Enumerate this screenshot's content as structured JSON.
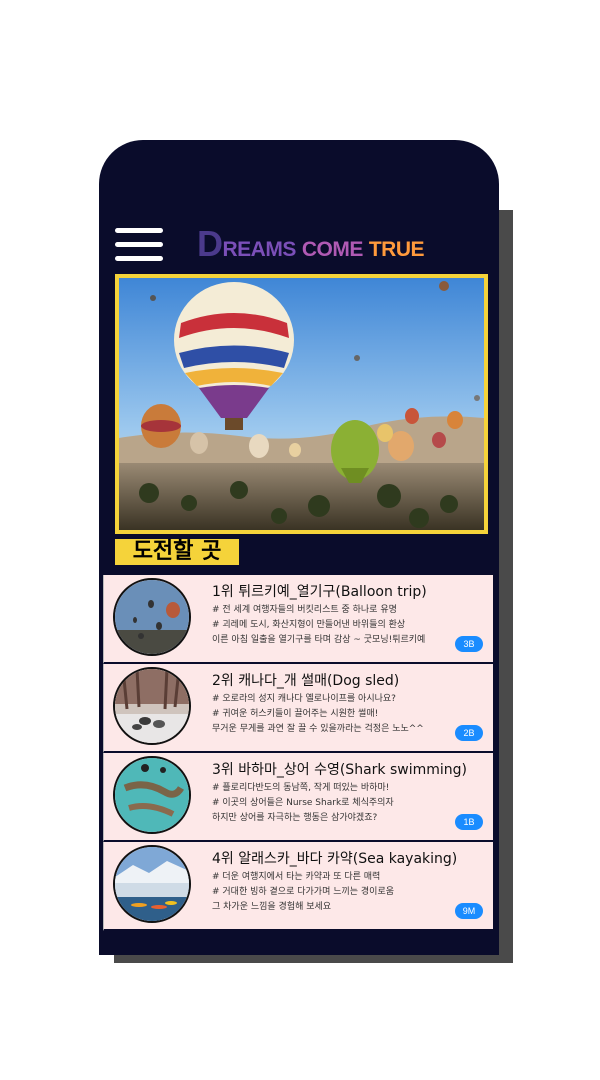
{
  "header": {
    "logo": {
      "d": "D",
      "reams": "REAMS",
      "come": "COME",
      "true": "TRUE",
      "colors": [
        "#4b3a8c",
        "#6a3fb0",
        "#8a55c6",
        "#c44fa0",
        "#ff8c3a",
        "#ffb347"
      ]
    }
  },
  "section_title": "도전할 곳",
  "items": [
    {
      "title": "1위 튀르키예_열기구(Balloon trip)",
      "lines": [
        "# 전 세계 여행자들의 버킷리스트 중 하나로 유명",
        "# 괴레메 도시, 화산지형이 만들어낸 바위들의 환상",
        "이른 아침 일출을 열기구를 타며 감상 ~ 굿모닝!튀르키예"
      ],
      "badge": "3B"
    },
    {
      "title": "2위 캐나다_개 썰매(Dog sled)",
      "lines": [
        "# 오로라의 성지 캐나다 옐로나이프를 아시나요?",
        "# 귀여운 허스키들이 끌어주는 시원한 썰매!",
        "무거운 무게를 과연 잘 끌 수 있을까라는 걱정은 노노^^"
      ],
      "badge": "2B"
    },
    {
      "title": "3위 바하마_상어 수영(Shark swimming)",
      "lines": [
        "# 플로리다반도의 동남쪽, 작게 떠있는 바하마!",
        "# 이곳의 상어들은 Nurse Shark로 체식주의자",
        " 하지만 상어를 자극하는 행동은 삼가야겠죠?"
      ],
      "badge": "1B"
    },
    {
      "title": "4위 알래스카_바다 카약(Sea kayaking)",
      "lines": [
        "# 더운 여행지에서 타는 카약과 또 다른 매력",
        "# 거대한 빙하 곁으로 다가가며 느끼는 경이로움",
        " 그 차가운 느낌을 경험해 보세요"
      ],
      "badge": "9M"
    }
  ]
}
